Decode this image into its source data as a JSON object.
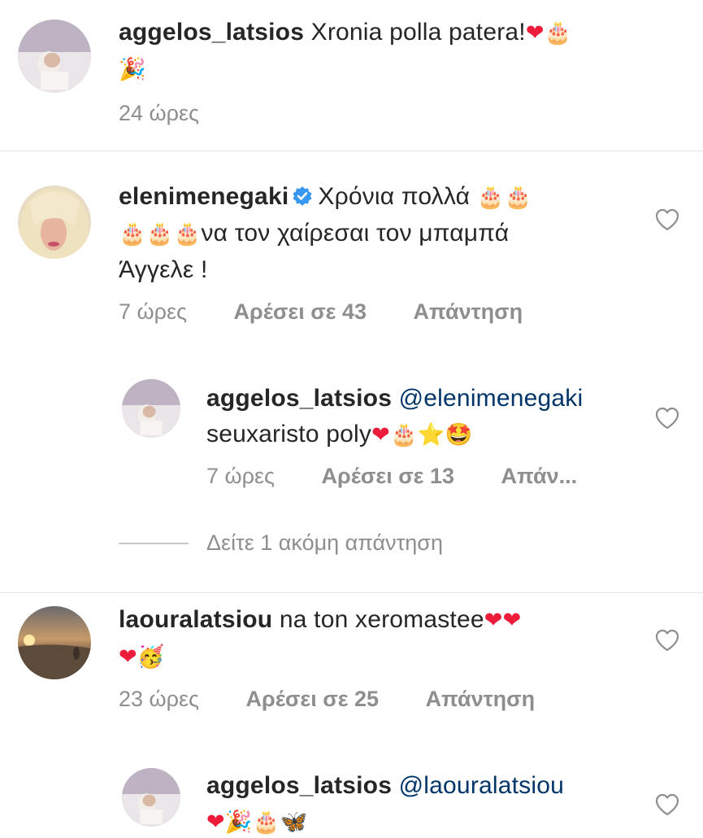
{
  "comments": [
    {
      "username": "aggelos_latsios",
      "text": "Xronia polla patera!",
      "emojis": [
        "❤",
        "🎂",
        "🎉"
      ],
      "time": "24 ώρες"
    },
    {
      "username": "elenimenegaki",
      "verified": true,
      "text_line1": "Χρόνια πολλά",
      "emojis_line1": [
        "🎂",
        "🎂"
      ],
      "emojis_line2": [
        "🎂",
        "🎂",
        "🎂"
      ],
      "text_line2": "να τον χαίρεσαι τον μπαμπά",
      "text_line3": "Άγγελε !",
      "time": "7 ώρες",
      "likes": "Αρέσει σε 43",
      "reply": "Απάντηση",
      "replies": [
        {
          "username": "aggelos_latsios",
          "mention": "@elenimenegaki",
          "text": "seuxaristo poly",
          "emojis": [
            "❤",
            "🎂",
            "⭐",
            "🤩"
          ],
          "time": "7 ώρες",
          "likes": "Αρέσει σε 13",
          "reply": "Απάν..."
        }
      ],
      "view_more": "Δείτε 1 ακόμη απάντηση"
    },
    {
      "username": "laouralatsiou",
      "text": "na ton xeromastee",
      "emojis_line1": [
        "❤",
        "❤"
      ],
      "emojis_line2": [
        "❤",
        "🥳"
      ],
      "time": "23 ώρες",
      "likes": "Αρέσει σε 25",
      "reply": "Απάντηση",
      "replies": [
        {
          "username": "aggelos_latsios",
          "mention": "@laouralatsiou",
          "emojis": [
            "❤",
            "🎉",
            "🎂",
            "🦋"
          ]
        }
      ]
    }
  ],
  "colors": {
    "text": "#262626",
    "meta": "#8e8e8e",
    "mention": "#003569",
    "verified": "#3897f0",
    "heart": "#ed1c3a"
  }
}
